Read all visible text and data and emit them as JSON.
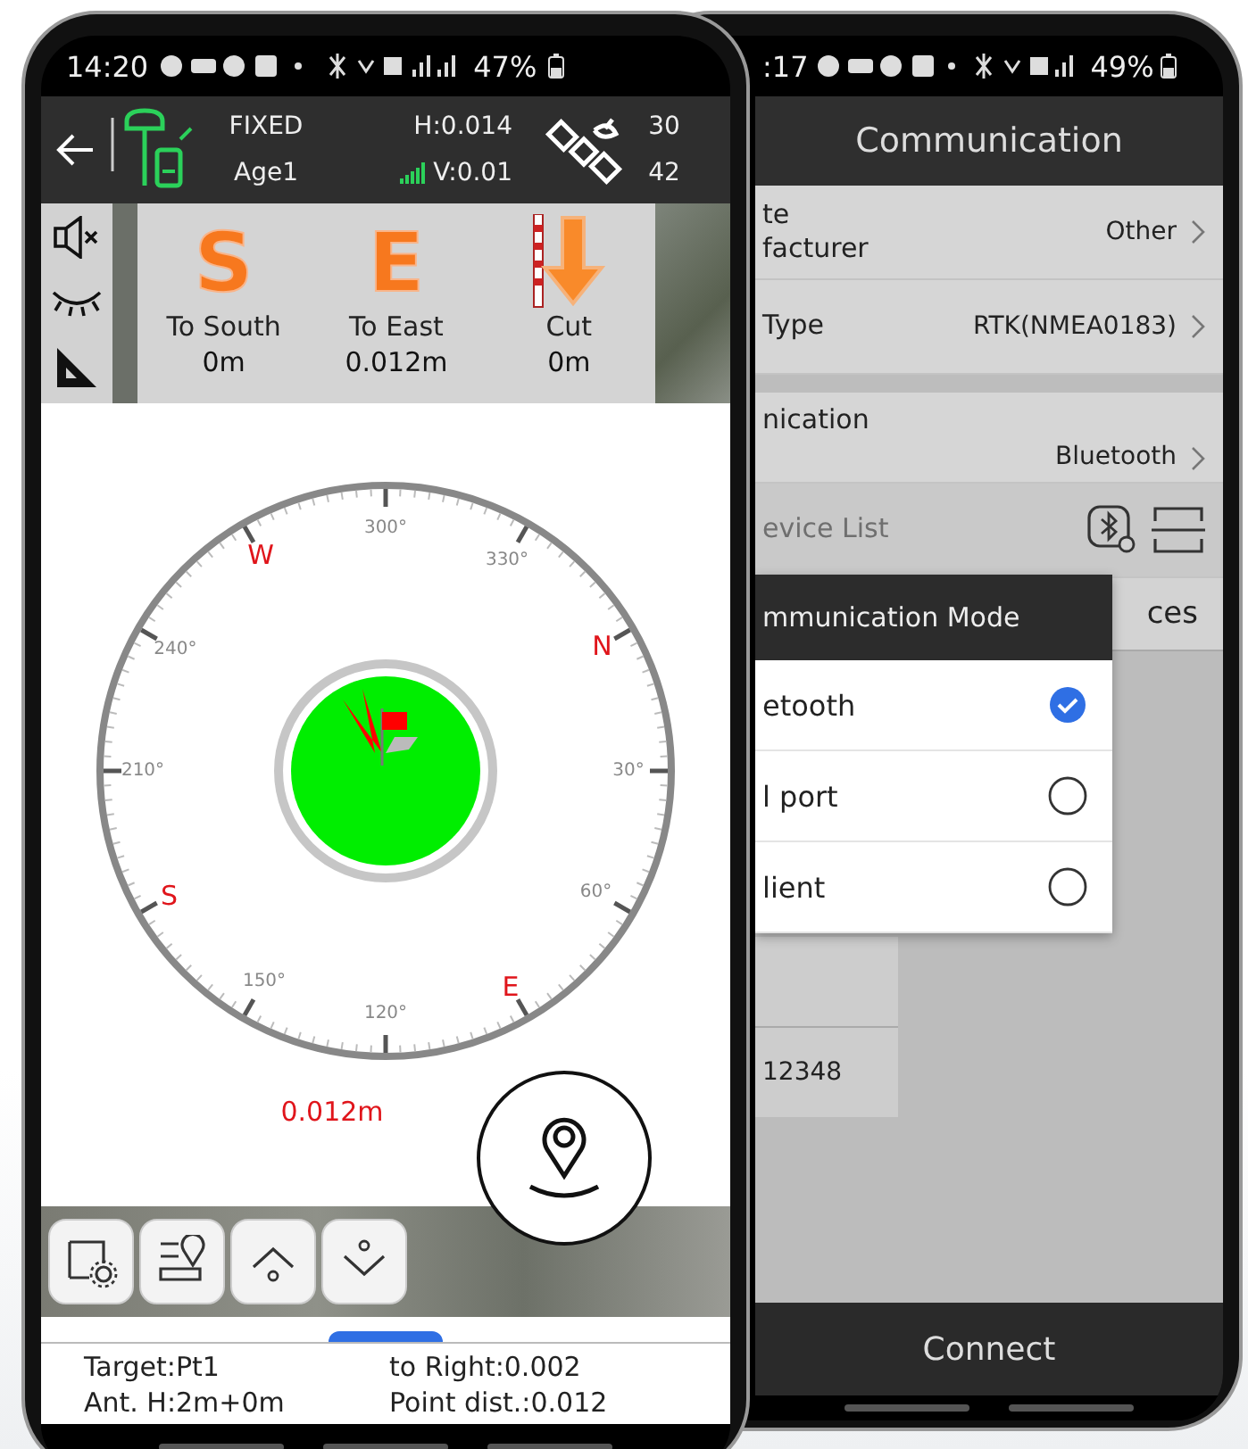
{
  "survey_phone": {
    "status_bar": {
      "time": "14:20",
      "battery": "47%"
    },
    "header": {
      "solution": "FIXED",
      "age": "Age1",
      "h_precision": "H:0.014",
      "v_precision": "V:0.01",
      "satellites_used": "30",
      "satellites_visible": "42"
    },
    "stakeout": [
      {
        "kind": "letter",
        "glyph": "S",
        "label": "To South",
        "value": "0m"
      },
      {
        "kind": "letter",
        "glyph": "E",
        "label": "To East",
        "value": "0.012m"
      },
      {
        "kind": "cut",
        "label": "Cut",
        "value": "0m"
      }
    ],
    "compass": {
      "dial_labels": [
        {
          "kind": "cardinal",
          "text": "N"
        },
        {
          "kind": "degree",
          "text": "30°"
        },
        {
          "kind": "degree",
          "text": "60°"
        },
        {
          "kind": "cardinal",
          "text": "E"
        },
        {
          "kind": "degree",
          "text": "120°"
        },
        {
          "kind": "degree",
          "text": "150°"
        },
        {
          "kind": "cardinal",
          "text": "S"
        },
        {
          "kind": "degree",
          "text": "210°"
        },
        {
          "kind": "degree",
          "text": "240°"
        },
        {
          "kind": "cardinal",
          "text": "W"
        },
        {
          "kind": "degree",
          "text": "300°"
        },
        {
          "kind": "degree",
          "text": "330°"
        }
      ],
      "distance": "0.012m"
    },
    "info": {
      "target": "Target:Pt1",
      "to_right": "to Right:0.002",
      "antenna_height": "Ant. H:2m+0m",
      "point_distance": "Point dist.:0.012"
    }
  },
  "settings_phone": {
    "status_bar": {
      "time": ":17",
      "battery": "49%"
    },
    "title": "Communication",
    "rows": [
      {
        "kind": "setting",
        "label_lines": [
          "te",
          "facturer"
        ],
        "value": "Other",
        "disabled": false
      },
      {
        "kind": "setting",
        "label_lines": [
          "Type"
        ],
        "value": "RTK(NMEA0183)",
        "disabled": false
      },
      {
        "kind": "setting_low",
        "label_lines": [
          "nication"
        ],
        "value": "Bluetooth",
        "disabled": false
      },
      {
        "kind": "tools",
        "label_lines": [
          "evice List"
        ],
        "disabled": true
      }
    ],
    "device_tab": "ces",
    "dialog": {
      "title": "mmunication Mode",
      "options": [
        {
          "label": "etooth",
          "selected": true
        },
        {
          "label": "l port",
          "selected": false
        },
        {
          "label": "lient",
          "selected": false
        }
      ]
    },
    "list_cell": "12348",
    "connect": "Connect"
  }
}
